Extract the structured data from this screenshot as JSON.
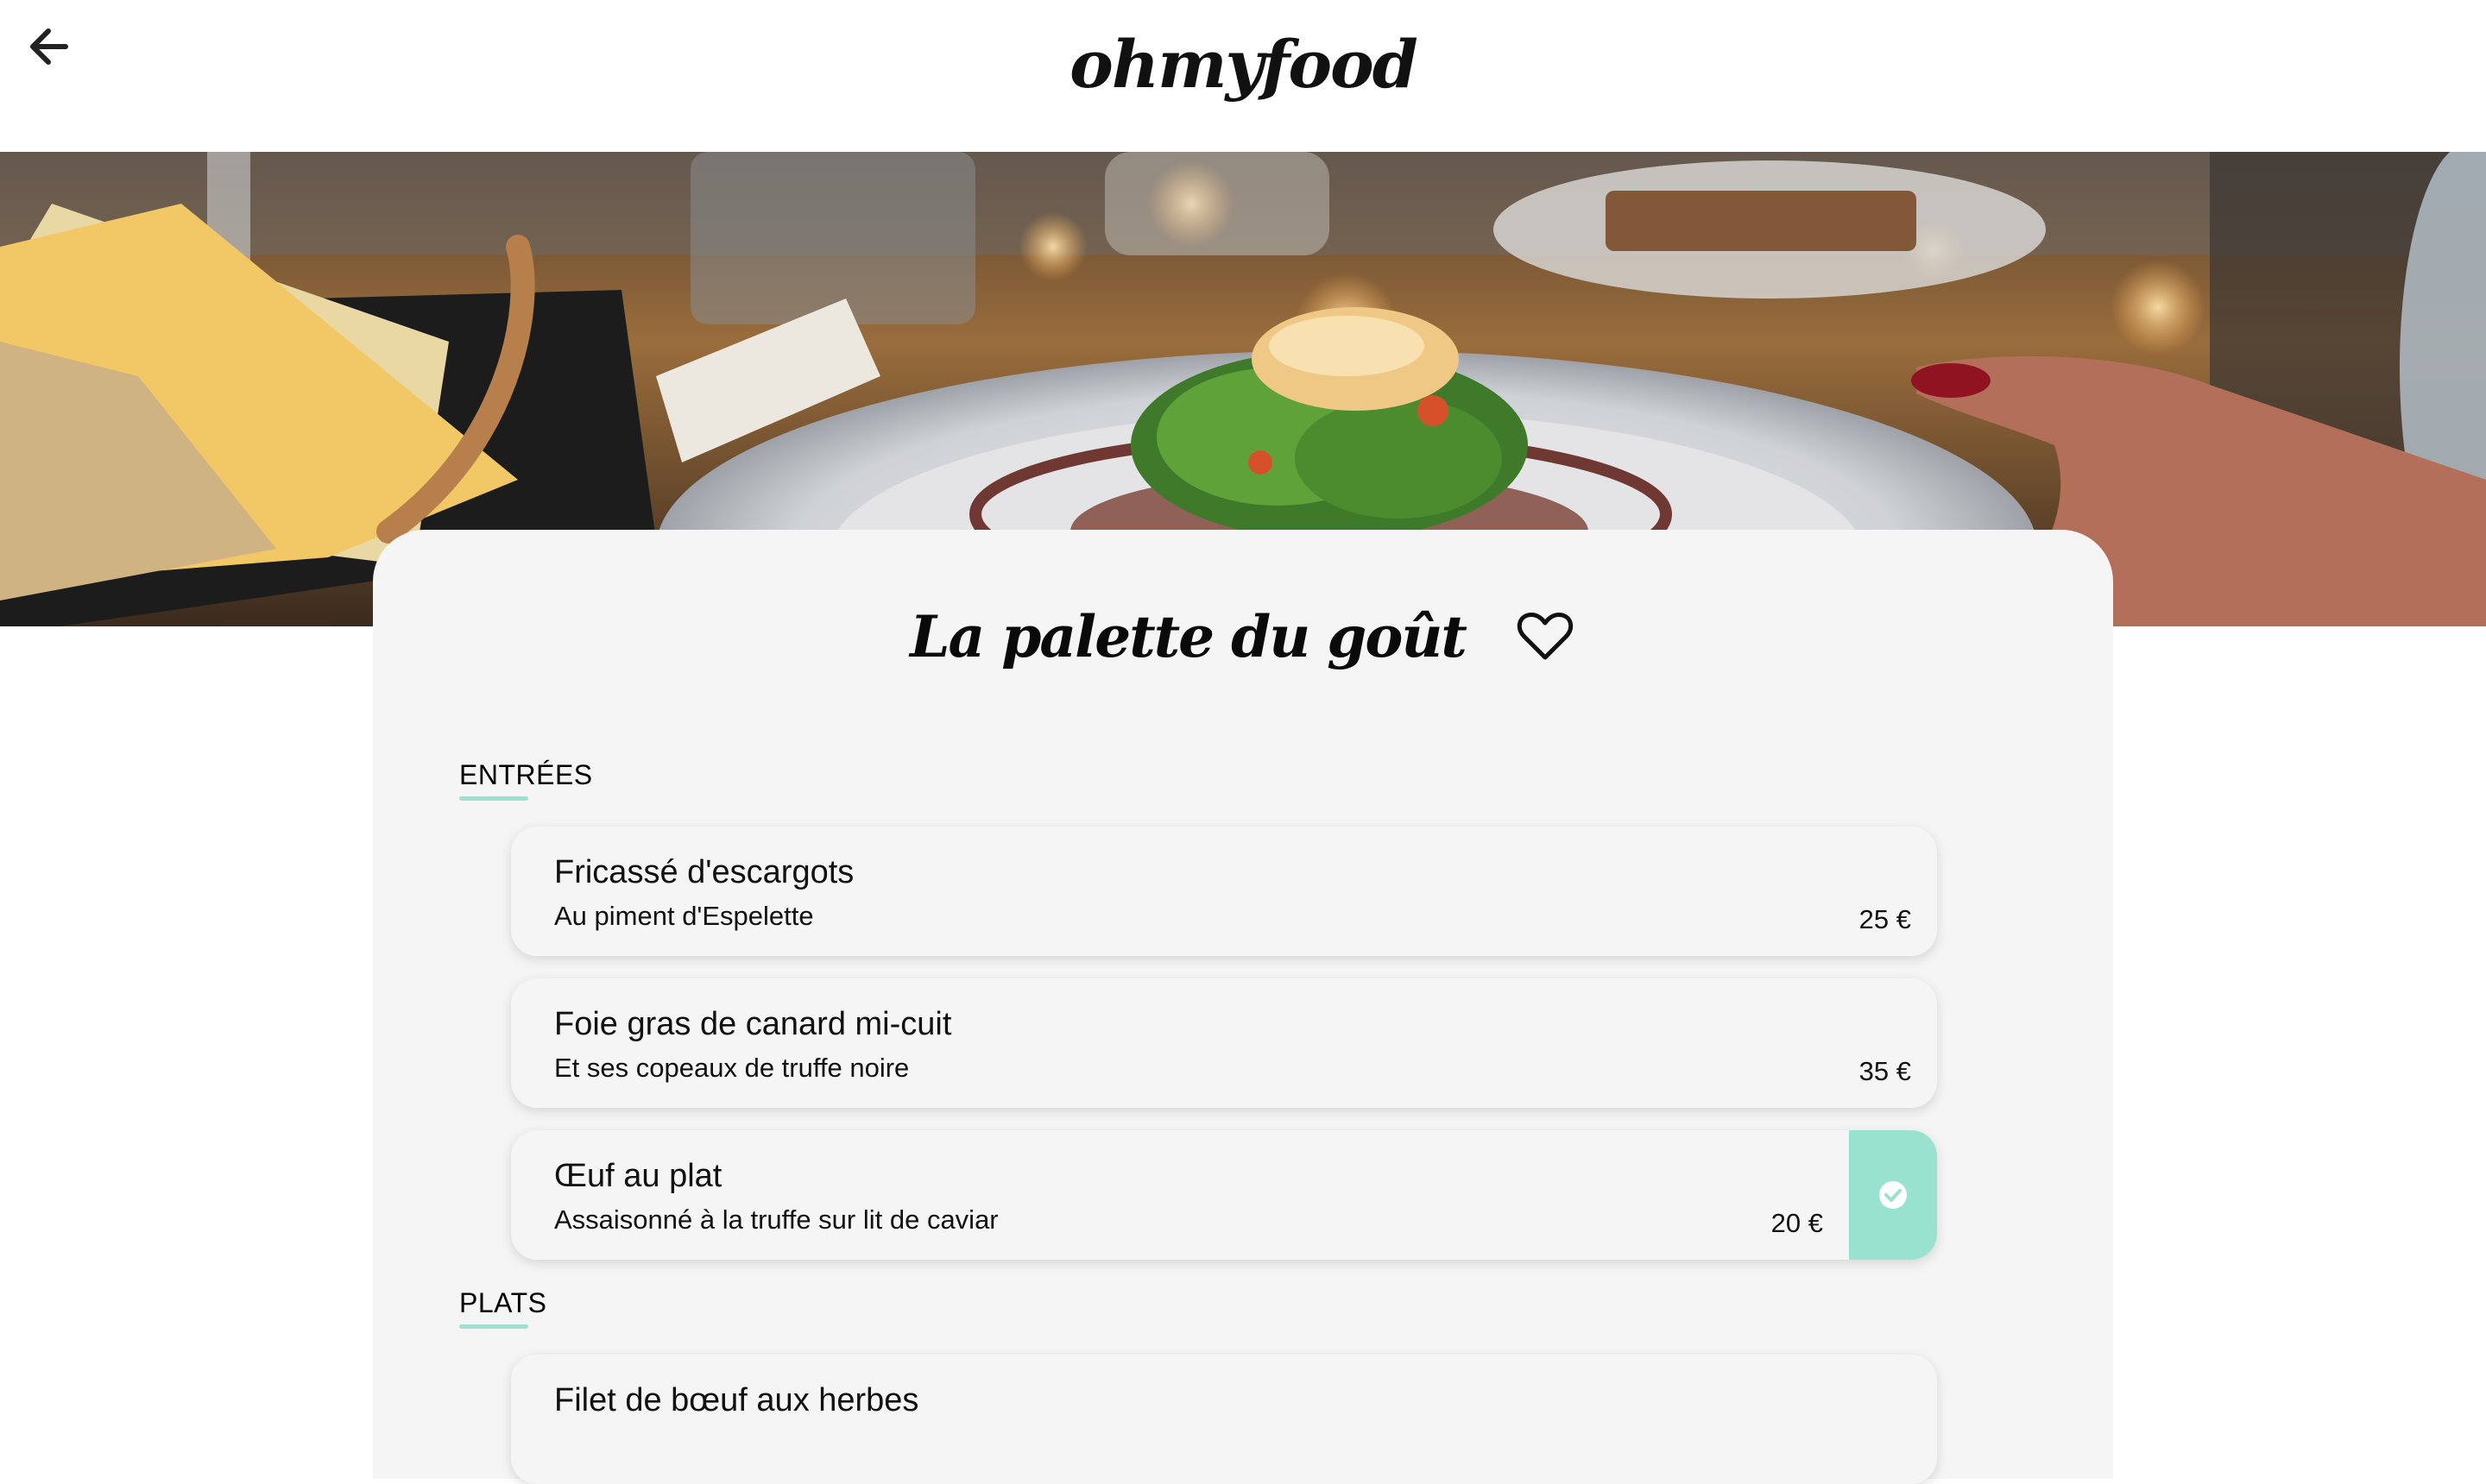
{
  "header": {
    "logo": "ohmyfood"
  },
  "restaurant": {
    "name": "La palette du goût"
  },
  "sections": [
    {
      "title": "ENTRÉES",
      "dishes": [
        {
          "name": "Fricassé d'escargots",
          "description": "Au piment d'Espelette",
          "price": "25 €",
          "selected": false
        },
        {
          "name": "Foie gras de canard mi-cuit",
          "description": "Et ses copeaux de truffe noire",
          "price": "35 €",
          "selected": false
        },
        {
          "name": "Œuf au plat",
          "description": "Assaisonné à la truffe sur lit de caviar",
          "price": "20 €",
          "selected": true
        }
      ]
    },
    {
      "title": "PLATS",
      "dishes": [
        {
          "name": "Filet de bœuf aux herbes",
          "description": "",
          "price": "",
          "selected": false
        }
      ]
    }
  ],
  "icons": {
    "back": "arrow-left-icon",
    "favorite": "heart-outline-icon",
    "selected": "check-circle-icon"
  },
  "colors": {
    "accent": "#99e2d0",
    "card_background": "#f5f5f5",
    "text": "#000000"
  }
}
